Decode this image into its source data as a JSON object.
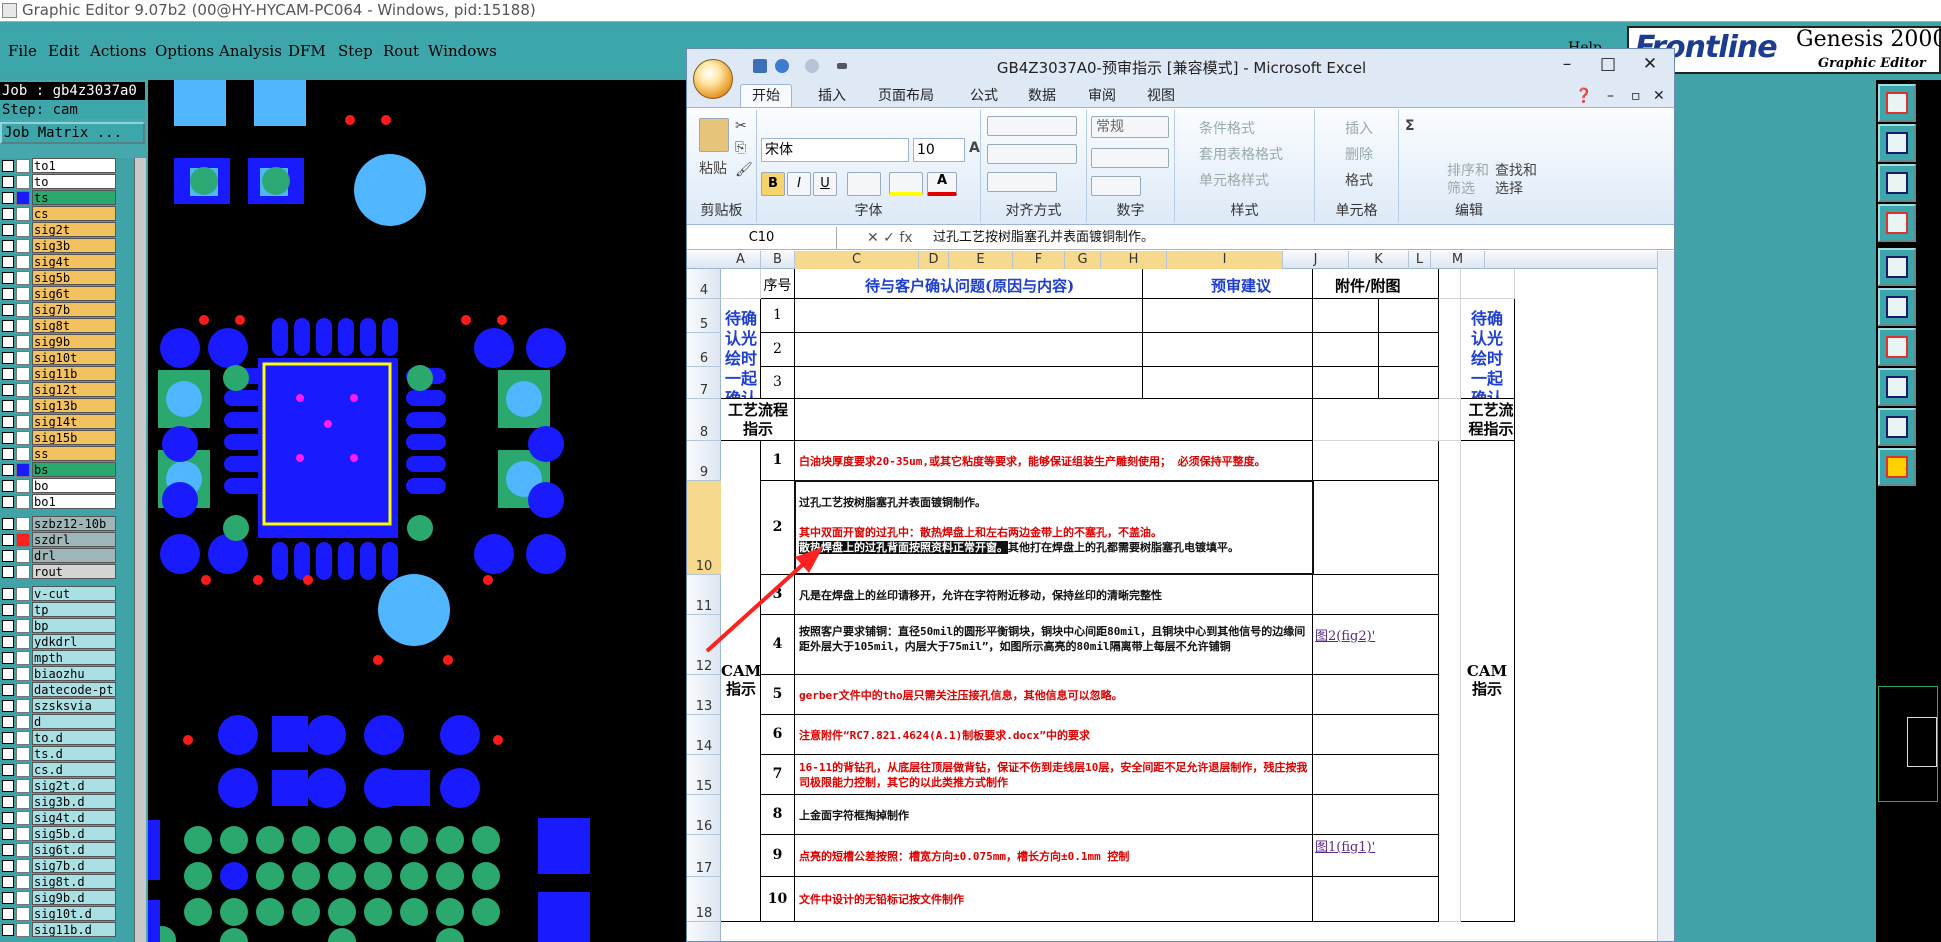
{
  "app": {
    "title": "Graphic Editor 9.07b2 (00@HY-HYCAM-PC064 - Windows, pid:15188)",
    "menus": [
      "File",
      "Edit",
      "Actions",
      "Options",
      "Analysis",
      "DFM",
      "Step",
      "Rout",
      "Windows"
    ],
    "help": "Help",
    "brand": {
      "logo": "Frontline",
      "product": "Genesis 2000 ®",
      "subtitle": "Graphic Editor"
    }
  },
  "left_panel": {
    "job": "Job : gb4z3037a0",
    "step": "Step: cam",
    "job_matrix": "Job Matrix ...",
    "layers": [
      {
        "name": "to1",
        "color": "#ffffff",
        "box": "#ffffff"
      },
      {
        "name": "to",
        "color": "#ffffff",
        "box": "#ffffff"
      },
      {
        "name": "ts",
        "color": "#2aa86e",
        "box": "#1a1aff"
      },
      {
        "name": "cs",
        "color": "#f2c261",
        "box": "#ffffff"
      },
      {
        "name": "sig2t",
        "color": "#f2c261",
        "box": "#ffffff"
      },
      {
        "name": "sig3b",
        "color": "#f2c261",
        "box": "#ffffff"
      },
      {
        "name": "sig4t",
        "color": "#f2c261",
        "box": "#ffffff"
      },
      {
        "name": "sig5b",
        "color": "#f2c261",
        "box": "#ffffff"
      },
      {
        "name": "sig6t",
        "color": "#f2c261",
        "box": "#ffffff"
      },
      {
        "name": "sig7b",
        "color": "#f2c261",
        "box": "#ffffff"
      },
      {
        "name": "sig8t",
        "color": "#f2c261",
        "box": "#ffffff"
      },
      {
        "name": "sig9b",
        "color": "#f2c261",
        "box": "#ffffff"
      },
      {
        "name": "sig10t",
        "color": "#f2c261",
        "box": "#ffffff"
      },
      {
        "name": "sig11b",
        "color": "#f2c261",
        "box": "#ffffff"
      },
      {
        "name": "sig12t",
        "color": "#f2c261",
        "box": "#ffffff"
      },
      {
        "name": "sig13b",
        "color": "#f2c261",
        "box": "#ffffff"
      },
      {
        "name": "sig14t",
        "color": "#f2c261",
        "box": "#ffffff"
      },
      {
        "name": "sig15b",
        "color": "#f2c261",
        "box": "#ffffff"
      },
      {
        "name": "ss",
        "color": "#f2c261",
        "box": "#ffffff"
      },
      {
        "name": "bs",
        "color": "#2aa86e",
        "box": "#1a1aff"
      },
      {
        "name": "bo",
        "color": "#ffffff",
        "box": "#ffffff"
      },
      {
        "name": "bo1",
        "color": "#ffffff",
        "box": "#ffffff"
      },
      {
        "name": "szbz12-10b",
        "color": "#9fb6b8",
        "box": "#ffffff"
      },
      {
        "name": "szdrl",
        "color": "#9fb6b8",
        "box": "#ff2020"
      },
      {
        "name": "drl",
        "color": "#9fb6b8",
        "box": "#ffffff"
      },
      {
        "name": "rout",
        "color": "#d4d4d4",
        "box": "#ffffff"
      },
      {
        "name": "v-cut",
        "color": "#a9e0e3",
        "box": "#ffffff"
      },
      {
        "name": "tp",
        "color": "#a9e0e3",
        "box": "#ffffff"
      },
      {
        "name": "bp",
        "color": "#a9e0e3",
        "box": "#ffffff"
      },
      {
        "name": "ydkdrl",
        "color": "#a9e0e3",
        "box": "#ffffff"
      },
      {
        "name": "mpth",
        "color": "#a9e0e3",
        "box": "#ffffff"
      },
      {
        "name": "biaozhu",
        "color": "#a9e0e3",
        "box": "#ffffff"
      },
      {
        "name": "datecode-pt",
        "color": "#a9e0e3",
        "box": "#ffffff"
      },
      {
        "name": "szsksvia",
        "color": "#a9e0e3",
        "box": "#ffffff"
      },
      {
        "name": "d",
        "color": "#a9e0e3",
        "box": "#ffffff"
      },
      {
        "name": "to.d",
        "color": "#a9e0e3",
        "box": "#ffffff"
      },
      {
        "name": "ts.d",
        "color": "#a9e0e3",
        "box": "#ffffff"
      },
      {
        "name": "cs.d",
        "color": "#a9e0e3",
        "box": "#ffffff"
      },
      {
        "name": "sig2t.d",
        "color": "#a9e0e3",
        "box": "#ffffff"
      },
      {
        "name": "sig3b.d",
        "color": "#a9e0e3",
        "box": "#ffffff"
      },
      {
        "name": "sig4t.d",
        "color": "#a9e0e3",
        "box": "#ffffff"
      },
      {
        "name": "sig5b.d",
        "color": "#a9e0e3",
        "box": "#ffffff"
      },
      {
        "name": "sig6t.d",
        "color": "#a9e0e3",
        "box": "#ffffff"
      },
      {
        "name": "sig7b.d",
        "color": "#a9e0e3",
        "box": "#ffffff"
      },
      {
        "name": "sig8t.d",
        "color": "#a9e0e3",
        "box": "#ffffff"
      },
      {
        "name": "sig9b.d",
        "color": "#a9e0e3",
        "box": "#ffffff"
      },
      {
        "name": "sig10t.d",
        "color": "#a9e0e3",
        "box": "#ffffff"
      },
      {
        "name": "sig11b.d",
        "color": "#a9e0e3",
        "box": "#ffffff"
      }
    ]
  },
  "excel": {
    "title": "GB4Z3037A0-预审指示  [兼容模式] - Microsoft Excel",
    "tabs": [
      "开始",
      "插入",
      "页面布局",
      "公式",
      "数据",
      "审阅",
      "视图"
    ],
    "groups": [
      "剪贴板",
      "字体",
      "对齐方式",
      "数字",
      "样式",
      "单元格",
      "编辑"
    ],
    "font_name": "宋体",
    "font_size": "10",
    "number_format": "常规",
    "paste": "粘贴",
    "style_items": [
      "条件格式",
      "套用表格格式",
      "单元格样式"
    ],
    "cell_items": [
      "插入",
      "删除",
      "格式"
    ],
    "edit_items": [
      "排序和筛选",
      "查找和选择"
    ],
    "name_box": "C10",
    "formula": "过孔工艺按树脂塞孔并表面镀铜制作。",
    "columns": [
      "A",
      "B",
      "C",
      "D",
      "E",
      "F",
      "G",
      "H",
      "I",
      "J",
      "K",
      "L",
      "M"
    ],
    "rows": [
      "4",
      "5",
      "6",
      "7",
      "8",
      "9",
      "10",
      "11",
      "12",
      "13",
      "14",
      "15",
      "16",
      "17",
      "18"
    ],
    "header": {
      "seq": "序号",
      "issue": "待与客户确认问题(原因与内容)",
      "suggest": "预审建议",
      "attach": "附件/附图"
    },
    "confirm_label": "待确认光绘时一起确认问题",
    "process_label": "工艺流程指示",
    "cam_label": "CAM指示",
    "confirm_rows": [
      "1",
      "2",
      "3"
    ],
    "items": [
      {
        "n": "1",
        "color": "red",
        "text": "白油块厚度要求20-35um,或其它粘度等要求，能够保证组装生产雕刻使用； 必须保持平整度。",
        "link": ""
      },
      {
        "n": "2",
        "color": "mixed",
        "line1": "过孔工艺按树脂塞孔并表面镀铜制作。",
        "line2": "其中双面开窗的过孔中：散热焊盘上和左右两边金带上的不塞孔，不盖油。",
        "line3sel": "散热焊盘上的过孔背面按照资料正常开窗。",
        "line3rest": "其他打在焊盘上的孔都需要树脂塞孔电镀填平。",
        "link": ""
      },
      {
        "n": "3",
        "color": "black",
        "text": "凡是在焊盘上的丝印请移开，允许在字符附近移动，保持丝印的清晰完整性",
        "link": ""
      },
      {
        "n": "4",
        "color": "black",
        "text": "按照客户要求铺铜：直径50mil的圆形平衡铜块，铜块中心间距80mil，且铜块中心到其他信号的边缘间距外层大于105mil，内层大于75mil”，如图所示高亮的80mil隔离带上每层不允许铺铜",
        "link": "图2(fig2)'"
      },
      {
        "n": "5",
        "color": "red",
        "text": "gerber文件中的tho层只需关注压接孔信息，其他信息可以忽略。",
        "link": ""
      },
      {
        "n": "6",
        "color": "red",
        "text": "注意附件“RC7.821.4624(A.1)制板要求.docx”中的要求",
        "link": ""
      },
      {
        "n": "7",
        "color": "red",
        "text": "16-11的背钻孔，从底层往顶层做背钻，保证不伤到走线层10层，安全间距不足允许退层制作，残庄按我司极限能力控制，其它的以此类推方式制作",
        "link": ""
      },
      {
        "n": "8",
        "color": "black",
        "text": "上金面字符框掏掉制作",
        "link": ""
      },
      {
        "n": "9",
        "color": "red",
        "text": "点亮的短槽公差按照：槽宽方向±0.075mm，槽长方向±0.1mm 控制",
        "link": "图1(fig1)'"
      },
      {
        "n": "10",
        "color": "red",
        "text": "文件中设计的无铅标记按文件制作",
        "link": ""
      }
    ]
  }
}
